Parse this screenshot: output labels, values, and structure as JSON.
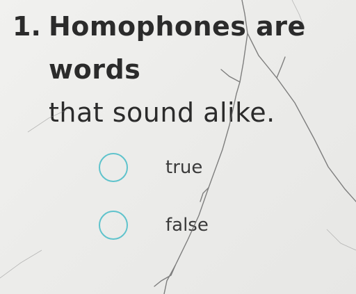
{
  "question": {
    "number": "1.",
    "text_line1": "Homophones are words",
    "text_line2": "that sound alike."
  },
  "options": [
    {
      "label": "true",
      "selected": false
    },
    {
      "label": "false",
      "selected": false
    }
  ],
  "colors": {
    "radio_border": "#5fc3cc",
    "text": "#2b2b2b",
    "background": "#ececea"
  }
}
